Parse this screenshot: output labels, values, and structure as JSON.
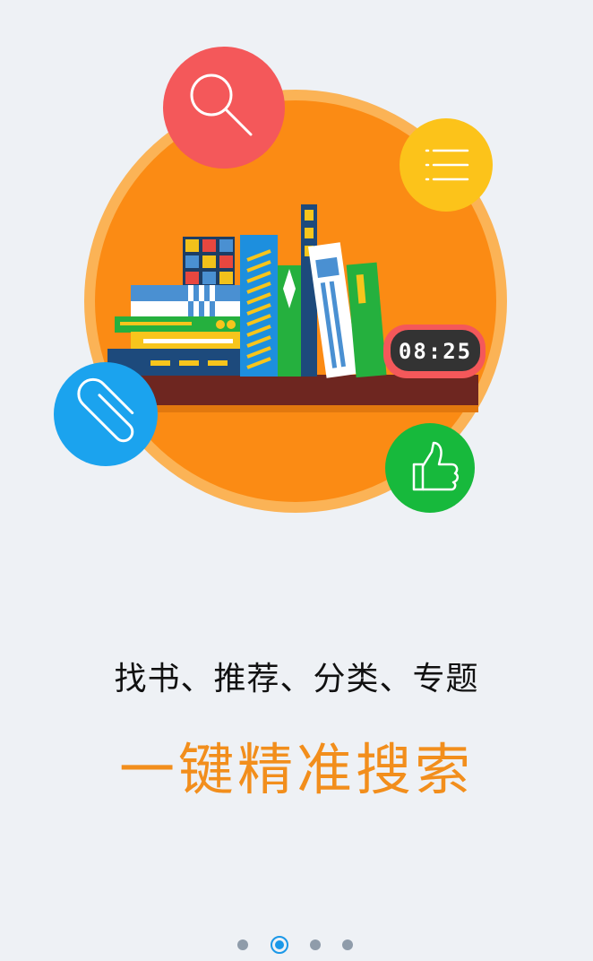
{
  "guide": {
    "subtitle": "找书、推荐、分类、专题",
    "headline": "一键精准搜索",
    "headline_color": "#f28e1c",
    "clock_text": "08:25",
    "icons": [
      "search-icon",
      "menu-list-icon",
      "paperclip-icon",
      "thumbs-up-icon"
    ],
    "colors": {
      "big_circle": "#fb8b14",
      "search_bubble": "#f4585a",
      "menu_bubble": "#fcc31a",
      "clip_bubble": "#1ba3ee",
      "like_bubble": "#17b93c"
    }
  },
  "pager": {
    "page_count": 4,
    "active_index": 1
  }
}
